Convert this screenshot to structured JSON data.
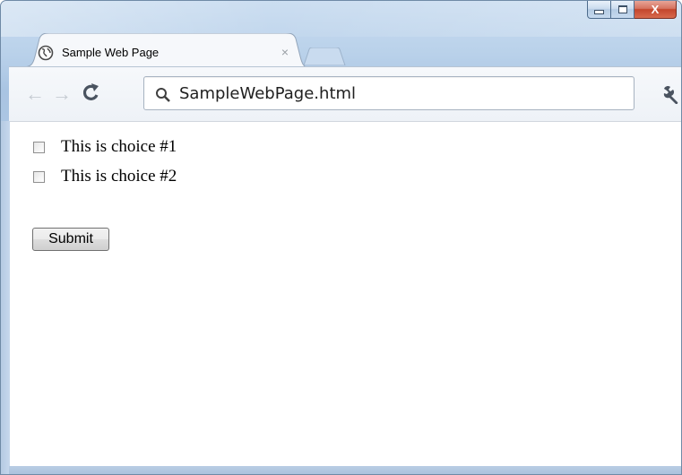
{
  "window": {
    "caption_buttons": [
      "minimize",
      "maximize",
      "close"
    ],
    "close_label": "X"
  },
  "tabs": [
    {
      "title": "Sample Web Page",
      "close_label": "×",
      "icon": "globe-icon",
      "active": true
    }
  ],
  "toolbar": {
    "back_icon": "←",
    "forward_icon": "→",
    "reload_icon": "reload-icon",
    "address": "SampleWebPage.html",
    "menu_icon": "wrench-icon"
  },
  "page": {
    "choices": [
      {
        "label": "This is choice #1",
        "checked": false
      },
      {
        "label": "This is choice #2",
        "checked": false
      }
    ],
    "submit_label": "Submit"
  },
  "colors": {
    "frame": "#b9d1ea",
    "close_button": "#c3452d",
    "disabled_nav": "#c5cbd2"
  }
}
